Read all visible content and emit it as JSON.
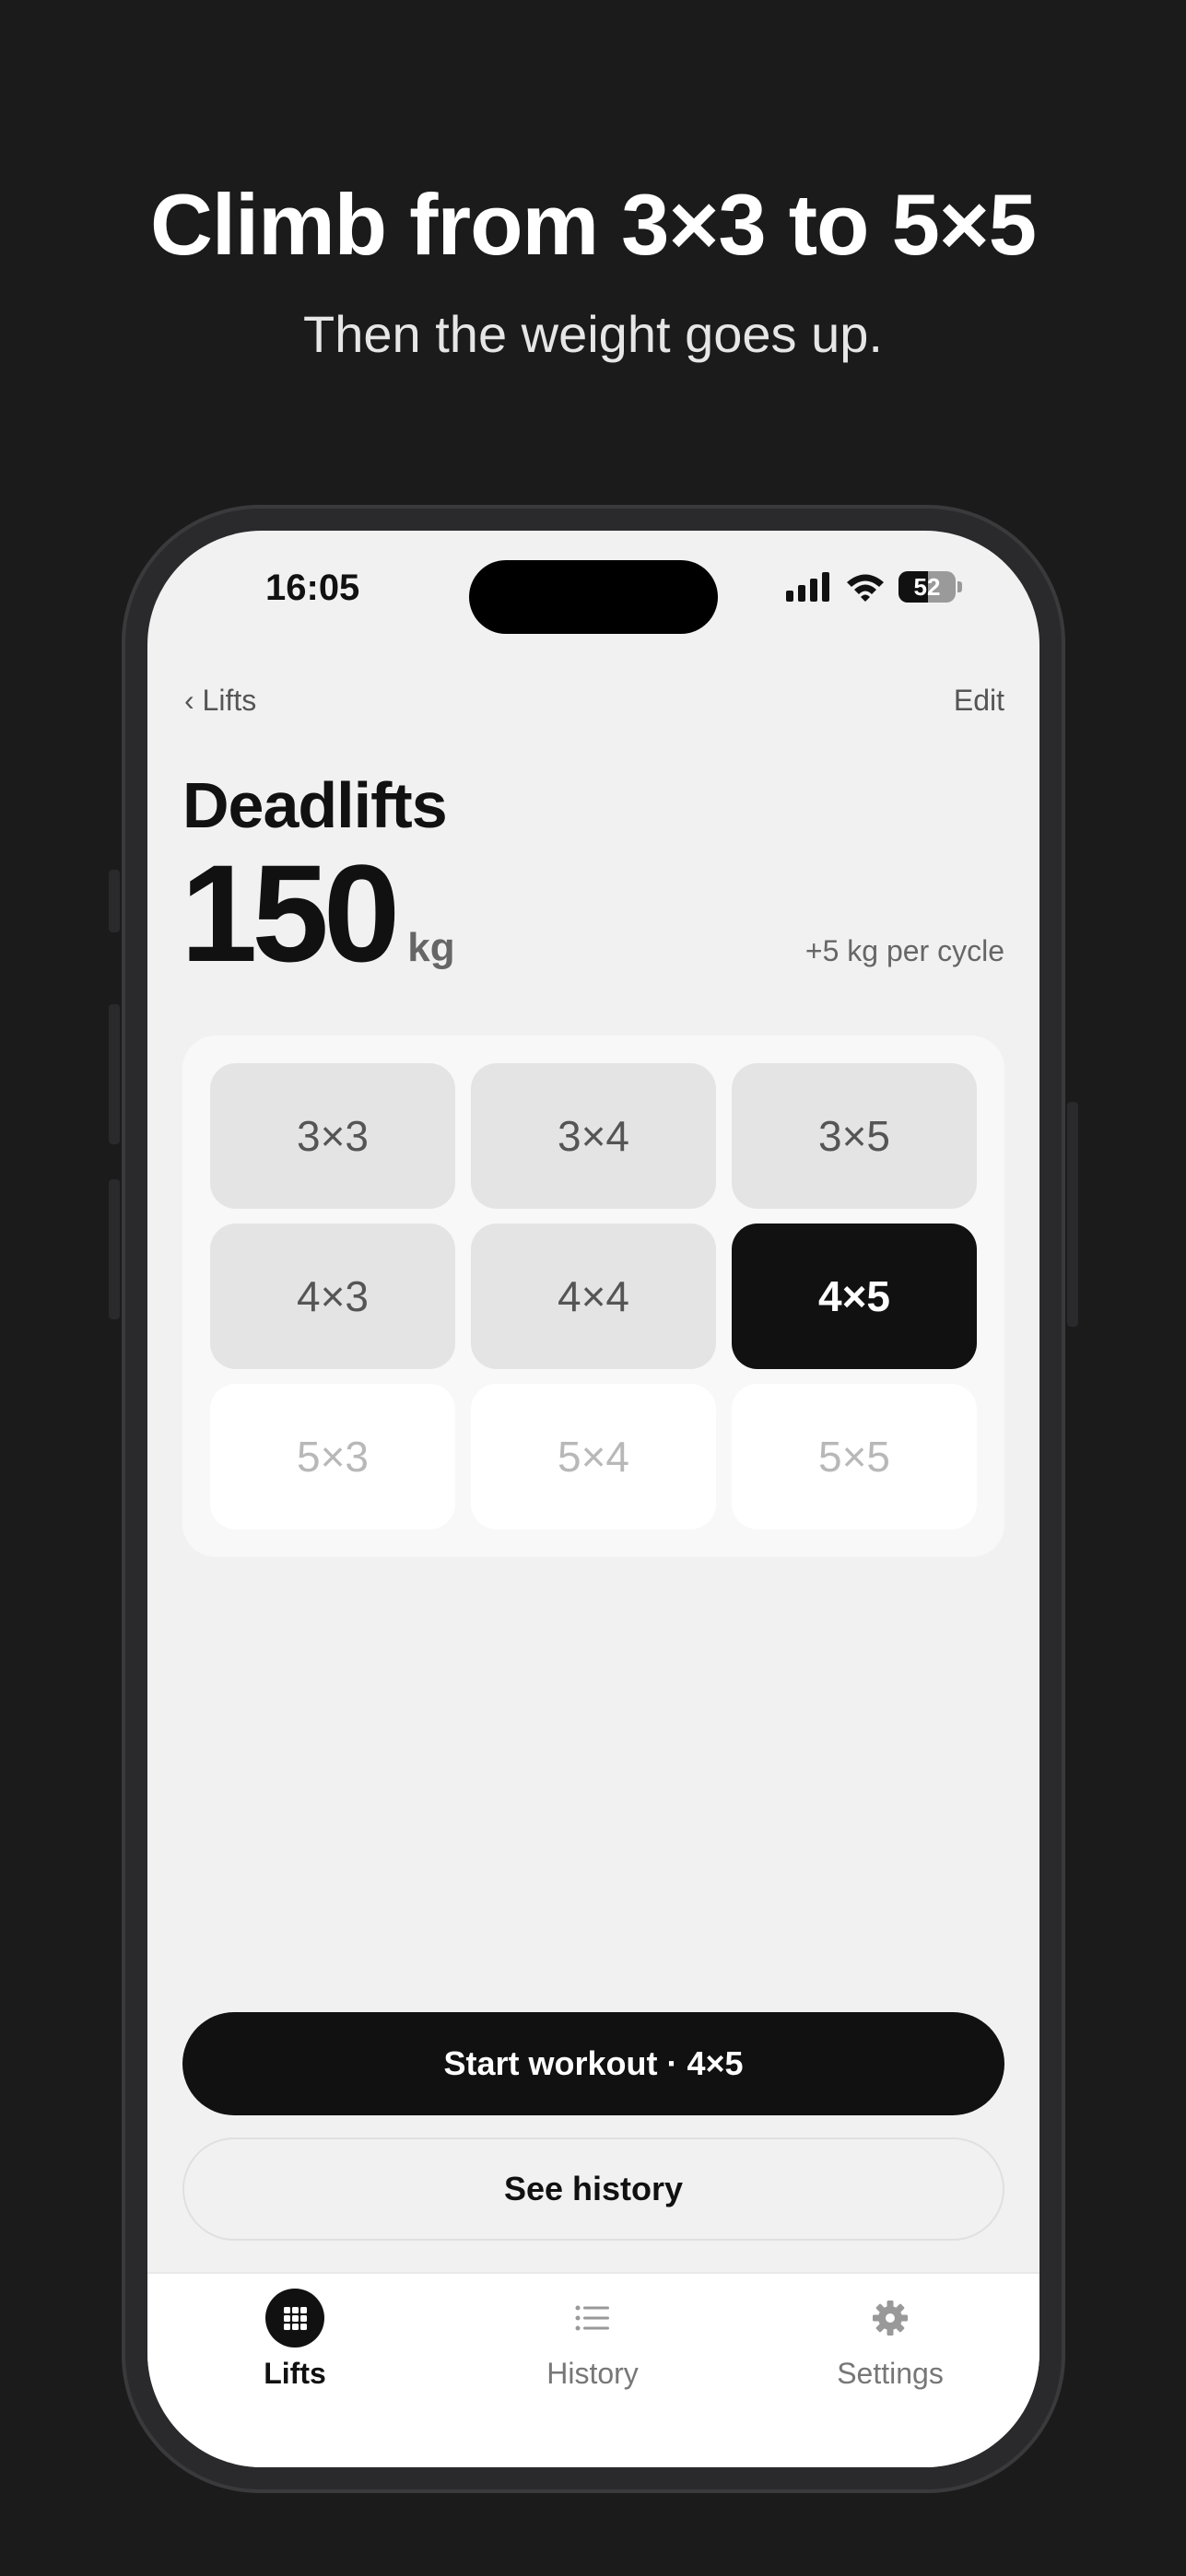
{
  "headline": "Climb from 3×3 to 5×5",
  "subheadline": "Then the weight goes up.",
  "status_bar": {
    "time": "16:05",
    "battery": "52"
  },
  "nav": {
    "back_label": "‹ Lifts",
    "edit_label": "Edit"
  },
  "lift": {
    "name": "Deadlifts",
    "weight": "150",
    "unit": "kg",
    "increment": "+5 kg per cycle"
  },
  "progression_grid": [
    {
      "label": "3×3",
      "state": "done"
    },
    {
      "label": "3×4",
      "state": "done"
    },
    {
      "label": "3×5",
      "state": "done"
    },
    {
      "label": "4×3",
      "state": "done"
    },
    {
      "label": "4×4",
      "state": "done"
    },
    {
      "label": "4×5",
      "state": "current"
    },
    {
      "label": "5×3",
      "state": "todo"
    },
    {
      "label": "5×4",
      "state": "todo"
    },
    {
      "label": "5×5",
      "state": "todo"
    }
  ],
  "actions": {
    "start_workout": "Start workout · 4×5",
    "see_history": "See history"
  },
  "tabs": [
    {
      "label": "Lifts",
      "icon": "grid-icon",
      "active": true
    },
    {
      "label": "History",
      "icon": "list-icon",
      "active": false
    },
    {
      "label": "Settings",
      "icon": "gear-icon",
      "active": false
    }
  ],
  "colors": {
    "background": "#1b1b1b",
    "screen": "#f1f1f1",
    "accent": "#111111"
  }
}
